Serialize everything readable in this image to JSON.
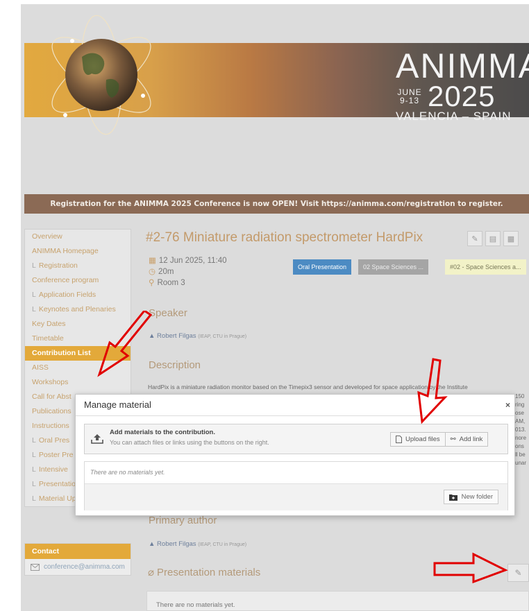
{
  "banner": {
    "brand": "ANIMMA",
    "dates": "JUNE 9-13",
    "year": "2025",
    "location": "VALENCIA – SPAIN"
  },
  "announcement": "Registration for the ANIMMA 2025 Conference is now OPEN! Visit https://animma.com/registration to register.",
  "sidebar": {
    "items": [
      {
        "label": "Overview",
        "sub": false,
        "active": false
      },
      {
        "label": "ANIMMA Homepage",
        "sub": false,
        "active": false
      },
      {
        "label": "Registration",
        "sub": true,
        "active": false
      },
      {
        "label": "Conference program",
        "sub": false,
        "active": false
      },
      {
        "label": "Application Fields",
        "sub": true,
        "active": false
      },
      {
        "label": "Keynotes and Plenaries",
        "sub": true,
        "active": false
      },
      {
        "label": "Key Dates",
        "sub": false,
        "active": false
      },
      {
        "label": "Timetable",
        "sub": false,
        "active": false
      },
      {
        "label": "Contribution List",
        "sub": false,
        "active": true
      },
      {
        "label": "AISS",
        "sub": false,
        "active": false
      },
      {
        "label": "Workshops",
        "sub": false,
        "active": false
      },
      {
        "label": "Call for Abst",
        "sub": false,
        "active": false
      },
      {
        "label": "Publications",
        "sub": false,
        "active": false
      },
      {
        "label": "Instructions",
        "sub": false,
        "active": false
      },
      {
        "label": "Oral Pres",
        "sub": true,
        "active": false
      },
      {
        "label": "Poster Pre",
        "sub": true,
        "active": false
      },
      {
        "label": "Intensive",
        "sub": true,
        "active": false
      },
      {
        "label": "Presentation Durations",
        "sub": true,
        "active": false
      },
      {
        "label": "Material Upload",
        "sub": true,
        "active": false
      }
    ],
    "contact_title": "Contact",
    "contact_email": "conference@animma.com"
  },
  "contribution": {
    "title": "#2-76 Miniature radiation spectrometer HardPix",
    "datetime": "12 Jun 2025, 11:40",
    "duration": "20m",
    "room": "Room 3",
    "badges": [
      "Oral Presentation",
      "02 Space Sciences ...",
      "#02 - Space Sciences a..."
    ],
    "speaker_heading": "Speaker",
    "speaker_name": "Robert Filgas",
    "speaker_affiliation": "(IEAP, CTU in Prague)",
    "description_heading": "Description",
    "description_text": "HardPix is a miniature radiation monitor based on the Timepix3 sensor and developed for space application by the Institute",
    "description_fragments": [
      "150",
      "ring",
      "ose",
      "AM,",
      "013.",
      "nore",
      "ons",
      "ll be",
      "unar"
    ],
    "primary_author_heading": "Primary author",
    "primary_author_name": "Robert Filgas",
    "primary_author_affiliation": "(IEAP, CTU in Prague)",
    "materials_heading": "Presentation materials",
    "materials_empty": "There are no materials yet."
  },
  "modal": {
    "title": "Manage material",
    "close": "×",
    "add_heading": "Add materials to the contribution.",
    "add_sub": "You can attach files or links using the buttons on the right.",
    "upload_label": "Upload files",
    "add_link_label": "Add link",
    "empty_text": "There are no materials yet.",
    "new_folder_label": "New folder"
  },
  "colors": {
    "accent": "#e3a93a",
    "arrow": "#e10000",
    "announce_bg": "#8b6a55",
    "badge_oral": "#4c8bc3"
  }
}
